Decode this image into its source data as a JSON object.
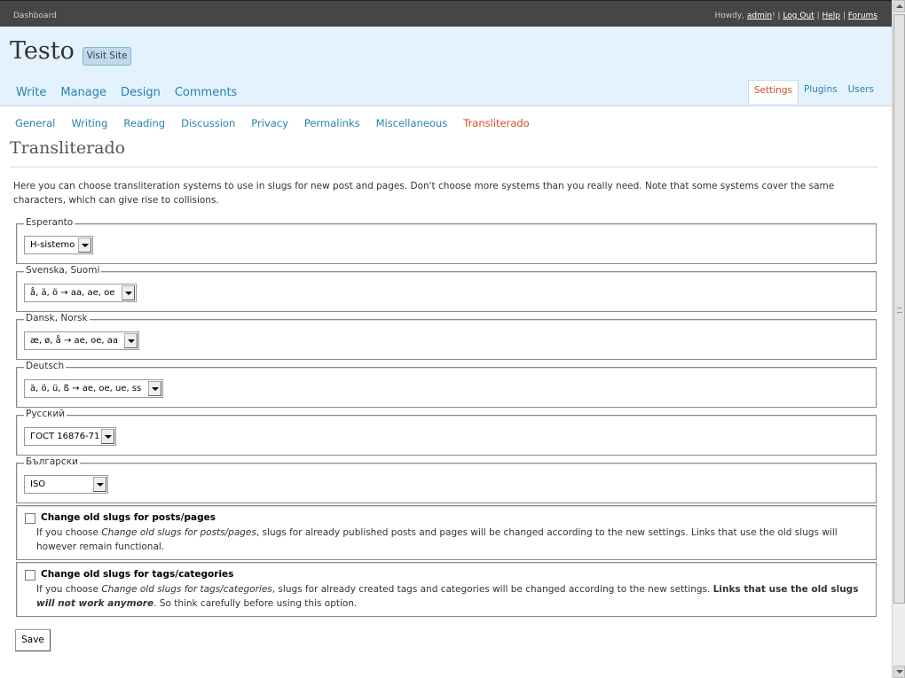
{
  "topbar": {
    "dashboard": "Dashboard",
    "howdy": "Howdy, ",
    "user": "admin",
    "after_user": "! | ",
    "logout": "Log Out",
    "help": "Help",
    "forums": "Forums",
    "sep": " | "
  },
  "site": {
    "title": "Testo",
    "visit_label": "Visit Site"
  },
  "main_nav": [
    "Write",
    "Manage",
    "Design",
    "Comments"
  ],
  "side_nav": [
    "Settings",
    "Plugins",
    "Users"
  ],
  "sub_nav": [
    "General",
    "Writing",
    "Reading",
    "Discussion",
    "Privacy",
    "Permalinks",
    "Miscellaneous",
    "Transliterado"
  ],
  "page": {
    "title": "Transliterado",
    "intro": "Here you can choose transliteration systems to use in slugs for new post and pages. Don't choose more systems than you really need. Note that some systems cover the same characters, which can give rise to collisions."
  },
  "languages": [
    {
      "legend": "Esperanto",
      "selected": "H-sistemo"
    },
    {
      "legend": "Svenska, Suomi",
      "selected": "å, ä, ö → aa, ae, oe"
    },
    {
      "legend": "Dansk, Norsk",
      "selected": "æ, ø, å → ae, oe, aa"
    },
    {
      "legend": "Deutsch",
      "selected": "ä, ö, ü, ß → ae, oe, ue, ss"
    },
    {
      "legend": "Русский",
      "selected": "ГОСТ 16876-71"
    },
    {
      "legend": "Български",
      "selected": "ISO"
    }
  ],
  "options": {
    "posts": {
      "label": "Change old slugs for posts/pages",
      "desc_pre": "If you choose ",
      "desc_em": "Change old slugs for posts/pages",
      "desc_post": ", slugs for already published posts and pages will be changed according to the new settings. Links that use the old slugs will however remain functional."
    },
    "tags": {
      "label": "Change old slugs for tags/categories",
      "desc_pre": "If you choose ",
      "desc_em": "Change old slugs for tags/categories",
      "desc_mid": ", slugs for already created tags and categories will be changed according to the new settings. ",
      "desc_bold": "Links that use the old slugs ",
      "desc_bold_em": "will not work anymore",
      "desc_post": ". So think carefully before using this option."
    }
  },
  "save_label": "Save"
}
